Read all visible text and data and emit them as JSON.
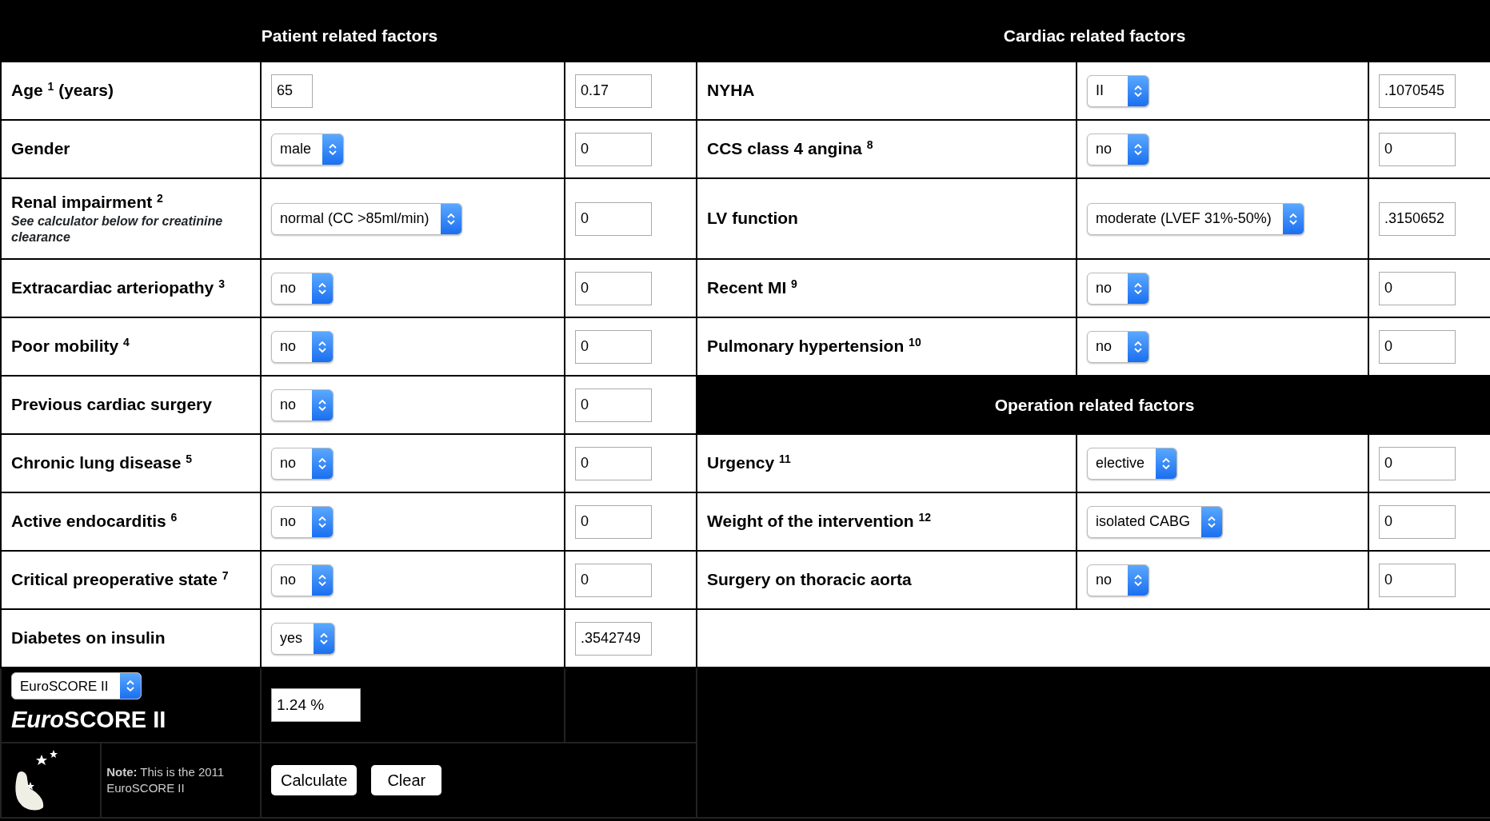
{
  "patient": {
    "title": "Patient related factors",
    "rows": [
      {
        "label": "Age $^{1}$ (years)",
        "control": {
          "kind": "input",
          "value": "65"
        },
        "weight": "0.17"
      },
      {
        "label": "Gender",
        "control": {
          "kind": "select",
          "value": "male"
        },
        "weight": "0"
      },
      {
        "label": "Renal impairment $^{2}$",
        "note": "See calculator below for creatinine clearance",
        "control": {
          "kind": "select",
          "value": "normal (CC >85ml/min)"
        },
        "weight": "0"
      },
      {
        "label": "Extracardiac arteriopathy $^{3}$",
        "control": {
          "kind": "select",
          "value": "no"
        },
        "weight": "0"
      },
      {
        "label": "Poor mobility $^{4}$",
        "control": {
          "kind": "select",
          "value": "no"
        },
        "weight": "0"
      },
      {
        "label": "Previous cardiac surgery",
        "control": {
          "kind": "select",
          "value": "no"
        },
        "weight": "0"
      },
      {
        "label": "Chronic lung disease $^{5}$",
        "control": {
          "kind": "select",
          "value": "no"
        },
        "weight": "0"
      },
      {
        "label": "Active endocarditis $^{6}$",
        "control": {
          "kind": "select",
          "value": "no"
        },
        "weight": "0"
      },
      {
        "label": "Critical preoperative state $^{7}$",
        "control": {
          "kind": "select",
          "value": "no"
        },
        "weight": "0"
      },
      {
        "label": "Diabetes on insulin",
        "control": {
          "kind": "select",
          "value": "yes"
        },
        "weight": ".3542749"
      }
    ]
  },
  "right_sections": [
    {
      "title": "Cardiac related factors",
      "rows": [
        {
          "label": "NYHA",
          "control": {
            "kind": "select",
            "value": "II"
          },
          "weight": ".1070545"
        },
        {
          "label": "CCS class 4 angina $^{8}$",
          "control": {
            "kind": "select",
            "value": "no"
          },
          "weight": "0"
        },
        {
          "label": "LV function",
          "control": {
            "kind": "select",
            "value": "moderate (LVEF 31%-50%)"
          },
          "weight": ".3150652"
        },
        {
          "label": "Recent MI $^{9}$",
          "control": {
            "kind": "select",
            "value": "no"
          },
          "weight": "0"
        },
        {
          "label": "Pulmonary hypertension $^{10}$",
          "control": {
            "kind": "select",
            "value": "no"
          },
          "weight": "0"
        }
      ]
    },
    {
      "title": "Operation related factors",
      "rows": [
        {
          "label": "Urgency $^{11}$",
          "control": {
            "kind": "select",
            "value": "elective"
          },
          "weight": "0"
        },
        {
          "label": "Weight of the intervention $^{12}$",
          "control": {
            "kind": "select",
            "value": "isolated CABG"
          },
          "weight": "0"
        },
        {
          "label": "Surgery on thoracic aorta",
          "control": {
            "kind": "select",
            "value": "no"
          },
          "weight": "0"
        }
      ]
    }
  ],
  "score": {
    "model": "EuroSCORE II",
    "logo": {
      "italic_part": "Euro",
      "plain_part": "SCORE II"
    },
    "result": "1.24 %",
    "note": "**Note:** This is the 2011 EuroSCORE II",
    "buttons": [
      "Calculate",
      "Clear"
    ]
  }
}
